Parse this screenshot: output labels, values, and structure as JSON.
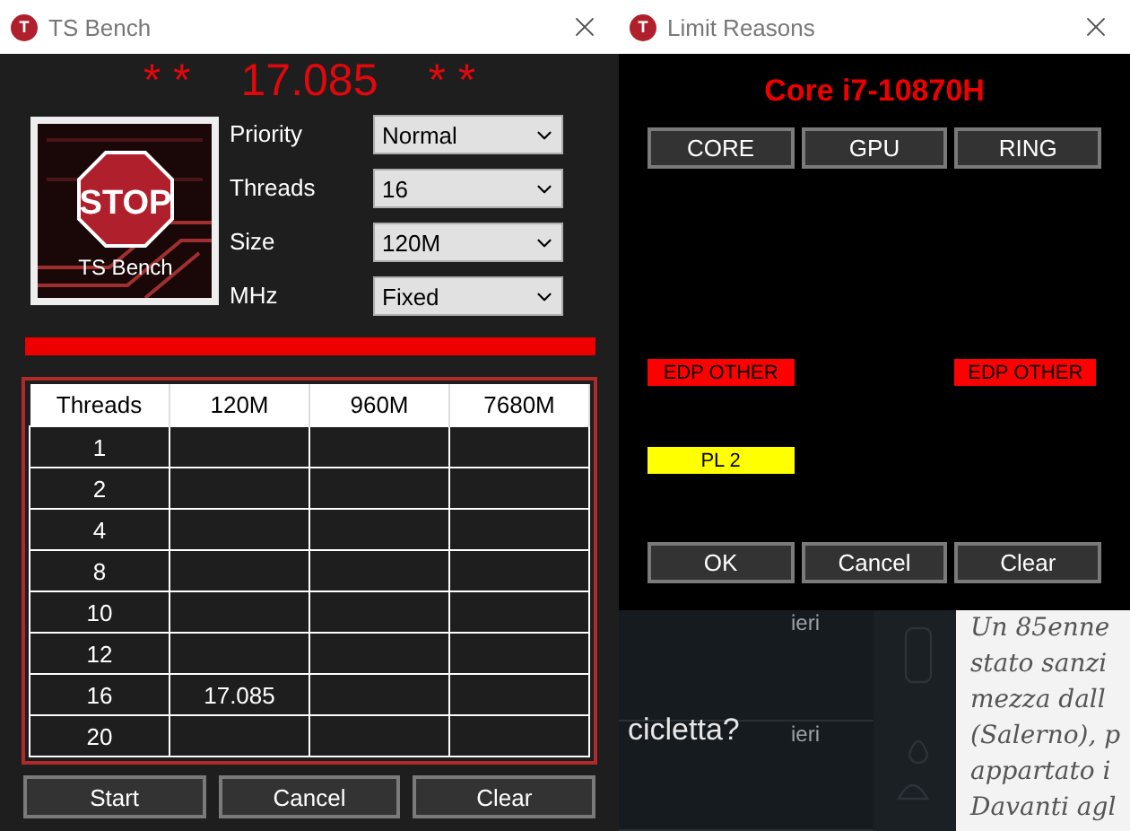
{
  "bench_window": {
    "title": "TS Bench",
    "icon_letter": "T",
    "score": "17.085",
    "score_marks": "*  *",
    "logo": {
      "sign": "STOP",
      "caption": "TS Bench"
    },
    "settings": [
      {
        "label": "Priority",
        "value": "Normal"
      },
      {
        "label": "Threads",
        "value": "16"
      },
      {
        "label": "Size",
        "value": "120M"
      },
      {
        "label": "MHz",
        "value": "Fixed"
      }
    ],
    "table": {
      "columns": [
        "Threads",
        "120M",
        "960M",
        "7680M"
      ],
      "rows": [
        {
          "cells": [
            "1"
          ]
        },
        {
          "cells": [
            "2"
          ]
        },
        {
          "cells": [
            "4"
          ]
        },
        {
          "cells": [
            "8"
          ]
        },
        {
          "cells": [
            "10"
          ]
        },
        {
          "cells": [
            "12"
          ]
        },
        {
          "cells": [
            "16",
            "17.085"
          ]
        },
        {
          "cells": [
            "20"
          ]
        }
      ]
    },
    "buttons": [
      "Start",
      "Cancel",
      "Clear"
    ]
  },
  "limit_window": {
    "title": "Limit Reasons",
    "icon_letter": "T",
    "cpu": "Core i7-10870H",
    "columns": [
      {
        "label": "CORE",
        "reasons": [
          {
            "kind": "edp_other",
            "text": "EDP OTHER",
            "color": "#ff0000"
          },
          {
            "kind": "pl2",
            "text": "PL 2",
            "color": "#ffff00"
          }
        ]
      },
      {
        "label": "GPU"
      },
      {
        "label": "RING",
        "reasons": [
          {
            "kind": "edp_other",
            "text": "EDP OTHER",
            "color": "#ff0000"
          }
        ]
      }
    ],
    "buttons": [
      "OK",
      "Cancel",
      "Clear"
    ]
  },
  "background_page": {
    "chat_items": [
      {
        "time": "ieri"
      },
      {
        "title": "cicletta?",
        "time": "ieri"
      }
    ],
    "article_lines": [
      "Un 85enne",
      "stato sanzi",
      "mezza dall",
      "(Salerno), p",
      "appartato i",
      "Davanti agl"
    ]
  }
}
